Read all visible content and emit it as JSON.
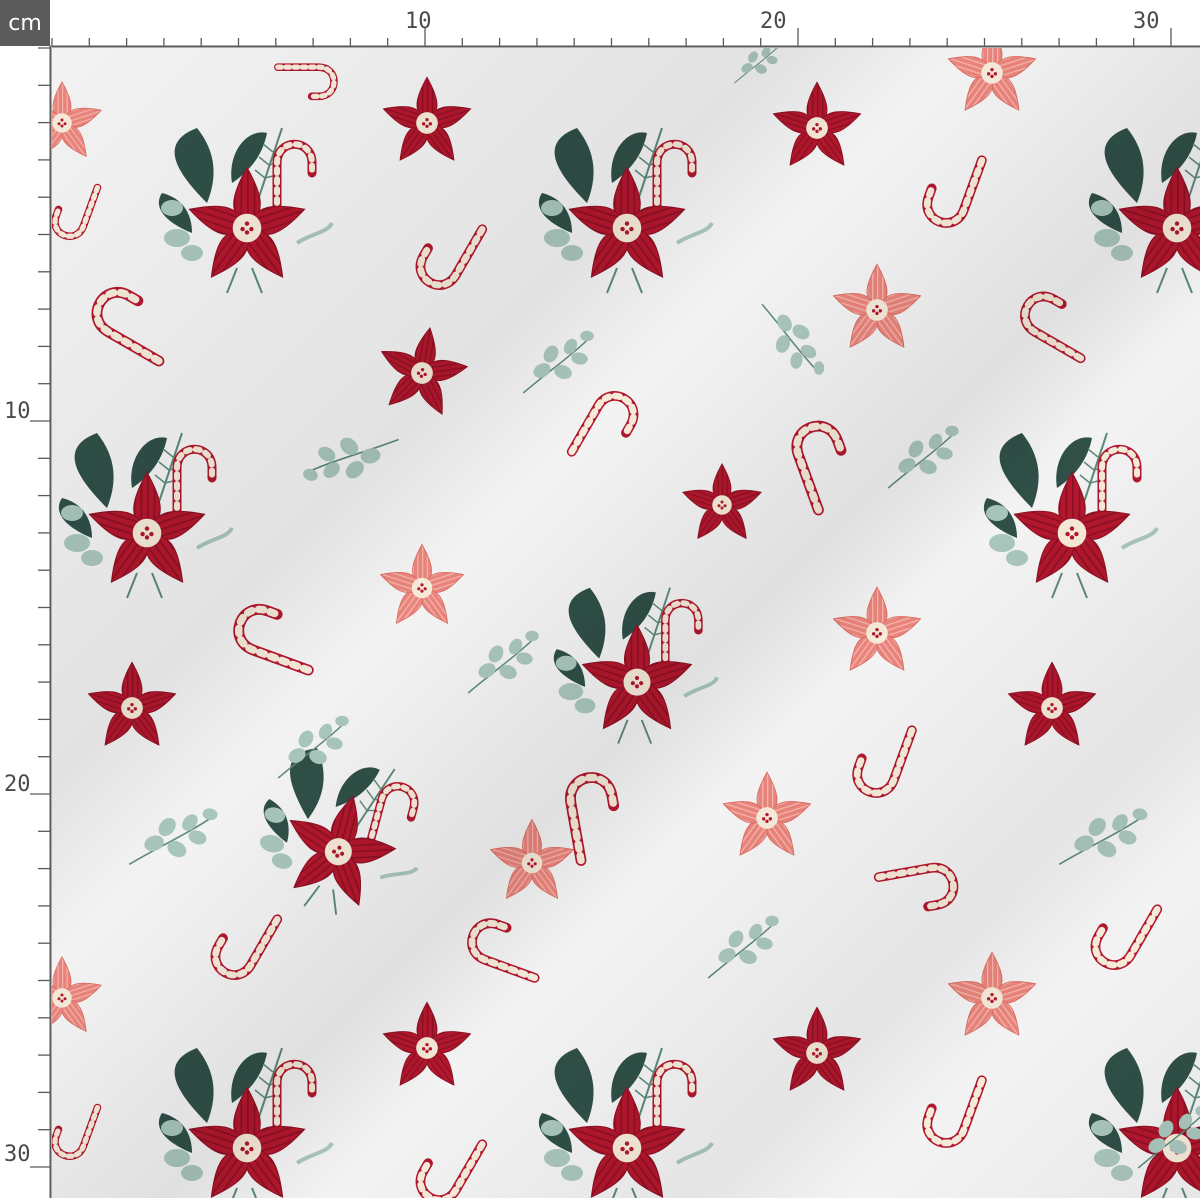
{
  "ruler": {
    "unit_label": "cm",
    "top_numbers": [
      "10",
      "20",
      "30"
    ],
    "left_numbers": [
      "10",
      "20",
      "30"
    ]
  },
  "fabric": {
    "background": "#f2f3f2",
    "colors": {
      "crimson": "#b3172d",
      "deep_red": "#8e1024",
      "coral": "#e9847c",
      "coral_stripe": "#f6b4aa",
      "cream": "#f6ead9",
      "sage": "#a9c6bd",
      "dark_green": "#2f4f47",
      "pine": "#5c8a78"
    },
    "motifs": [
      "bouquet-motif",
      "red-poinsettia-motif",
      "pink-poinsettia-motif",
      "candy-cane-motif",
      "eucalyptus-sprig-motif"
    ]
  }
}
